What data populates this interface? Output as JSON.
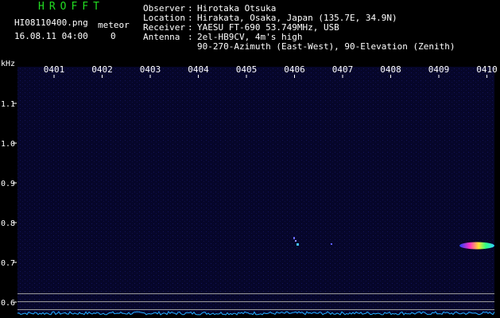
{
  "header": {
    "title": "HROFFT",
    "filename": "HI08110400.png",
    "datetime": "16.08.11 04:00",
    "meteor_label": "meteor",
    "meteor_count": "0",
    "observer_label": "Observer",
    "observer_value": "Hirotaka Otsuka",
    "location_label": "Location",
    "location_value": "Hirakata, Osaka, Japan (135.7E, 34.9N)",
    "receiver_label": "Receiver",
    "receiver_value": "YAESU FT-690 53.749MHz, USB",
    "antenna_label": "Antenna",
    "antenna_value": "2el-HB9CV, 4m's high",
    "antenna_value2": "90-270-Azimuth (East-West), 90-Elevation (Zenith)"
  },
  "plot": {
    "y_unit": "kHz",
    "y_ticks": [
      "1.1",
      "1.0",
      "0.9",
      "0.8",
      "0.7",
      "0.6"
    ],
    "x_ticks": [
      "0401",
      "0402",
      "0403",
      "0404",
      "0405",
      "0406",
      "0407",
      "0408",
      "0409",
      "0410"
    ],
    "colors": {
      "background": "#000000",
      "spectrogram": "#06062a",
      "ticks": "#ffffff",
      "reference_lines": "#9a9a9a",
      "noise_floor": "#22b0ff",
      "title": "#22dd22"
    }
  }
}
